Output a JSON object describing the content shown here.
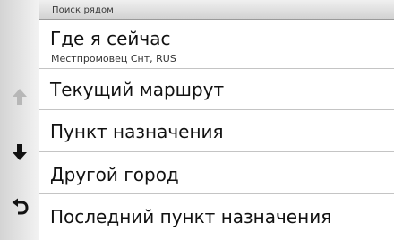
{
  "header": {
    "title": "Поиск рядом"
  },
  "list": {
    "items": [
      {
        "label": "Где я сейчас",
        "sublabel": "Местпромовец Снт, RUS"
      },
      {
        "label": "Текущий маршрут"
      },
      {
        "label": "Пункт назначения"
      },
      {
        "label": "Другой город"
      },
      {
        "label": "Последний пункт назначения"
      }
    ]
  },
  "nav": {
    "up_icon": "arrow-up-icon",
    "up_state": "disabled",
    "down_icon": "arrow-down-icon",
    "back_icon": "back-arrow-icon"
  },
  "colors": {
    "background": "#ffffff",
    "text": "#111111",
    "disabled_icon": "#b5b5b5",
    "header_bg": "#dcdcdc"
  }
}
